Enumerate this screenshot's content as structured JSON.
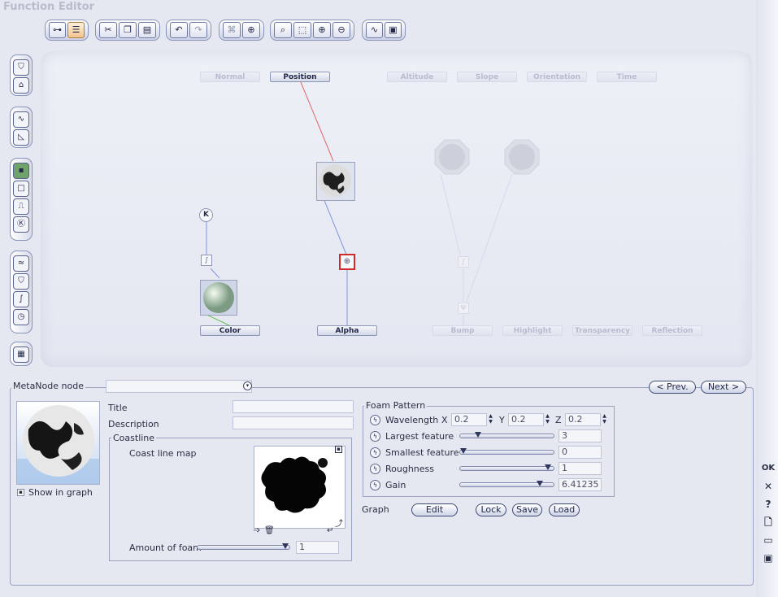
{
  "window": {
    "title": "Function Editor"
  },
  "right_tools": {
    "ok": "OK",
    "close": "✕",
    "help": "?"
  },
  "graph": {
    "inputs": [
      "Normal",
      "Position",
      "Altitude",
      "Slope",
      "Orientation",
      "Time"
    ],
    "outputs": [
      "Color",
      "Alpha",
      "Bump",
      "Highlight",
      "Transparency",
      "Reflection"
    ],
    "constant_glyph": "K"
  },
  "panel": {
    "metanode_label": "MetaNode node",
    "prev_label": "< Prev.",
    "next_label": "Next >",
    "show_in_graph_label": "Show in graph",
    "title_label": "Title",
    "description_label": "Description",
    "coastline": {
      "group_title": "Coastline",
      "map_label": "Coast line map",
      "amount_label": "Amount of foam",
      "amount_value": "1"
    },
    "foam": {
      "group_title": "Foam Pattern",
      "wavelength_label": "Wavelength",
      "x_label": "X",
      "x_value": "0.2",
      "y_label": "Y",
      "y_value": "0.2",
      "z_label": "Z",
      "z_value": "0.2",
      "largest_label": "Largest feature",
      "largest_value": "3",
      "smallest_label": "Smallest feature",
      "smallest_value": "0",
      "roughness_label": "Roughness",
      "roughness_value": "1",
      "gain_label": "Gain",
      "gain_value": "6.41235"
    },
    "graph_label": "Graph",
    "edit_label": "Edit",
    "lock_label": "Lock",
    "save_label": "Save",
    "load_label": "Load"
  },
  "colors": {
    "accent": "#8a93b8",
    "link_red": "#e06666",
    "link_blue": "#7f97e0",
    "link_green": "#5ec24a",
    "selected": "#d22b2b"
  }
}
